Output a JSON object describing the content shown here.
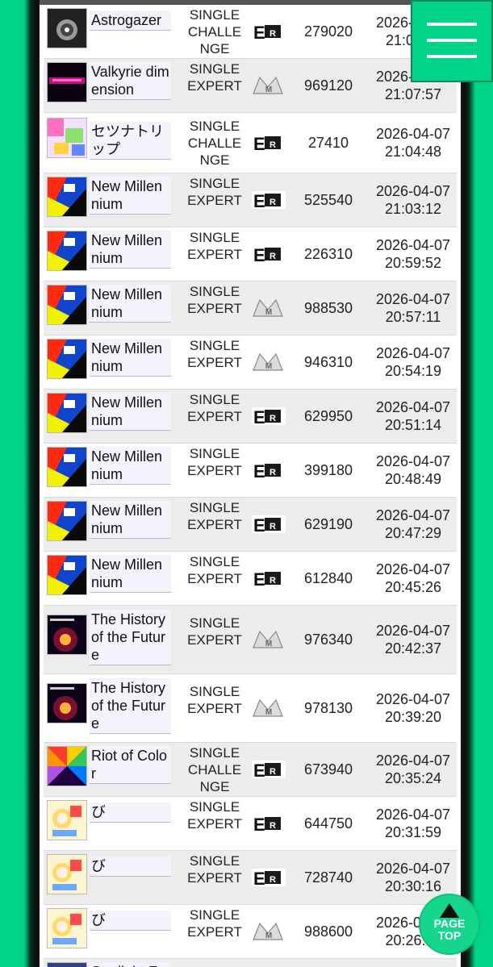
{
  "menu": {
    "icon": "hamburger-menu-icon"
  },
  "page_top": {
    "line1": "PAGE",
    "line2": "TOP",
    "icon": "arrow-up-icon"
  },
  "colors": {
    "accent": "#00d387",
    "row_alt": "#ececec"
  },
  "rows": [
    {
      "title": "Astrogazer",
      "mode": "SINGLE CHALLENGE",
      "difficulty": "expert-badge",
      "score": "279020",
      "date": "2026-04-07",
      "time": "21:09:xx",
      "thumb": "astrogazer"
    },
    {
      "title": "Valkyrie dimension",
      "mode": "SINGLE EXPERT",
      "difficulty": "master-badge",
      "score": "969120",
      "date": "2026-04-07",
      "time": "21:07:57",
      "thumb": "valkyrie"
    },
    {
      "title": "セツナトリップ",
      "mode": "SINGLE CHALLENGE",
      "difficulty": "expert-badge",
      "score": "27410",
      "date": "2026-04-07",
      "time": "21:04:48",
      "thumb": "setsuna"
    },
    {
      "title": "New Millennium",
      "mode": "SINGLE EXPERT",
      "difficulty": "expert-badge",
      "score": "525540",
      "date": "2026-04-07",
      "time": "21:03:12",
      "thumb": "millennium"
    },
    {
      "title": "New Millennium",
      "mode": "SINGLE EXPERT",
      "difficulty": "expert-badge",
      "score": "226310",
      "date": "2026-04-07",
      "time": "20:59:52",
      "thumb": "millennium"
    },
    {
      "title": "New Millennium",
      "mode": "SINGLE EXPERT",
      "difficulty": "master-badge",
      "score": "988530",
      "date": "2026-04-07",
      "time": "20:57:11",
      "thumb": "millennium"
    },
    {
      "title": "New Millennium",
      "mode": "SINGLE EXPERT",
      "difficulty": "master-badge",
      "score": "946310",
      "date": "2026-04-07",
      "time": "20:54:19",
      "thumb": "millennium"
    },
    {
      "title": "New Millennium",
      "mode": "SINGLE EXPERT",
      "difficulty": "expert-badge",
      "score": "629950",
      "date": "2026-04-07",
      "time": "20:51:14",
      "thumb": "millennium"
    },
    {
      "title": "New Millennium",
      "mode": "SINGLE EXPERT",
      "difficulty": "expert-badge",
      "score": "399180",
      "date": "2026-04-07",
      "time": "20:48:49",
      "thumb": "millennium"
    },
    {
      "title": "New Millennium",
      "mode": "SINGLE EXPERT",
      "difficulty": "expert-badge",
      "score": "629190",
      "date": "2026-04-07",
      "time": "20:47:29",
      "thumb": "millennium"
    },
    {
      "title": "New Millennium",
      "mode": "SINGLE EXPERT",
      "difficulty": "expert-badge",
      "score": "612840",
      "date": "2026-04-07",
      "time": "20:45:26",
      "thumb": "millennium"
    },
    {
      "title": "The History of the Future",
      "mode": "SINGLE EXPERT",
      "difficulty": "master-badge",
      "score": "976340",
      "date": "2026-04-07",
      "time": "20:42:37",
      "thumb": "history"
    },
    {
      "title": "The History of the Future",
      "mode": "SINGLE EXPERT",
      "difficulty": "master-badge",
      "score": "978130",
      "date": "2026-04-07",
      "time": "20:39:20",
      "thumb": "history"
    },
    {
      "title": "Riot of Color",
      "mode": "SINGLE CHALLENGE",
      "difficulty": "expert-badge",
      "score": "673940",
      "date": "2026-04-07",
      "time": "20:35:24",
      "thumb": "riot"
    },
    {
      "title": "び",
      "mode": "SINGLE EXPERT",
      "difficulty": "expert-badge",
      "score": "644750",
      "date": "2026-04-07",
      "time": "20:31:59",
      "thumb": "bi"
    },
    {
      "title": "び",
      "mode": "SINGLE EXPERT",
      "difficulty": "expert-badge",
      "score": "728740",
      "date": "2026-04-07",
      "time": "20:30:16",
      "thumb": "bi"
    },
    {
      "title": "び",
      "mode": "SINGLE EXPERT",
      "difficulty": "master-badge",
      "score": "988600",
      "date": "2026-04-07",
      "time": "20:26:1x",
      "thumb": "bi"
    },
    {
      "title": "Starlight Fa",
      "mode": "",
      "difficulty": "",
      "score": "",
      "date": "",
      "time": "",
      "thumb": "starlight"
    }
  ]
}
